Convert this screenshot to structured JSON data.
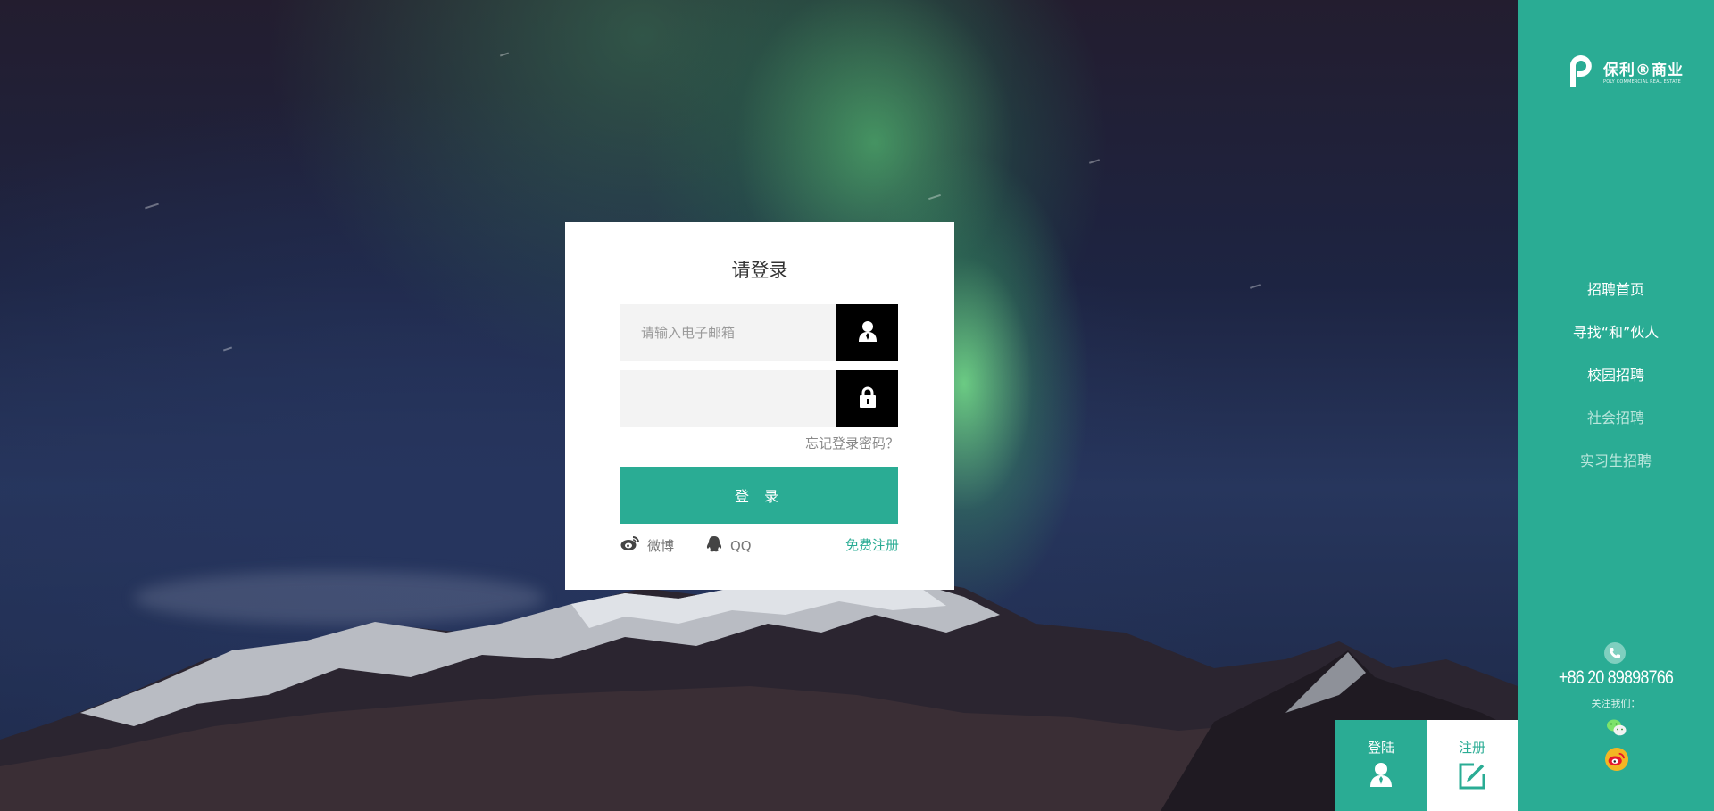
{
  "login_card": {
    "title": "请登录",
    "email_placeholder": "请输入电子邮箱",
    "password_value": "",
    "forgot_label": "忘记登录密码？",
    "submit_label": "登 录",
    "weibo_label": "微博",
    "qq_label": "QQ",
    "register_label": "免费注册"
  },
  "sidebar": {
    "logo_main": "保利®商业",
    "logo_sub": "POLY COMMERCIAL REAL ESTATE",
    "nav": [
      {
        "label": "招聘首页"
      },
      {
        "label": "寻找“和”伙人"
      },
      {
        "label": "校园招聘"
      },
      {
        "label": "社会招聘"
      },
      {
        "label": "实习生招聘"
      }
    ],
    "phone": "+86 20 89898766",
    "follow_label": "关注我们："
  },
  "tabs": {
    "login_label": "登陆",
    "register_label": "注册"
  },
  "colors": {
    "brand": "#2aac94",
    "icon_box": "#000000",
    "weibo_yellow": "#f3b623"
  },
  "icons": [
    "user-icon",
    "lock-icon",
    "weibo-icon",
    "qq-icon",
    "phone-icon",
    "wechat-icon",
    "edit-icon",
    "poly-logo-icon"
  ]
}
